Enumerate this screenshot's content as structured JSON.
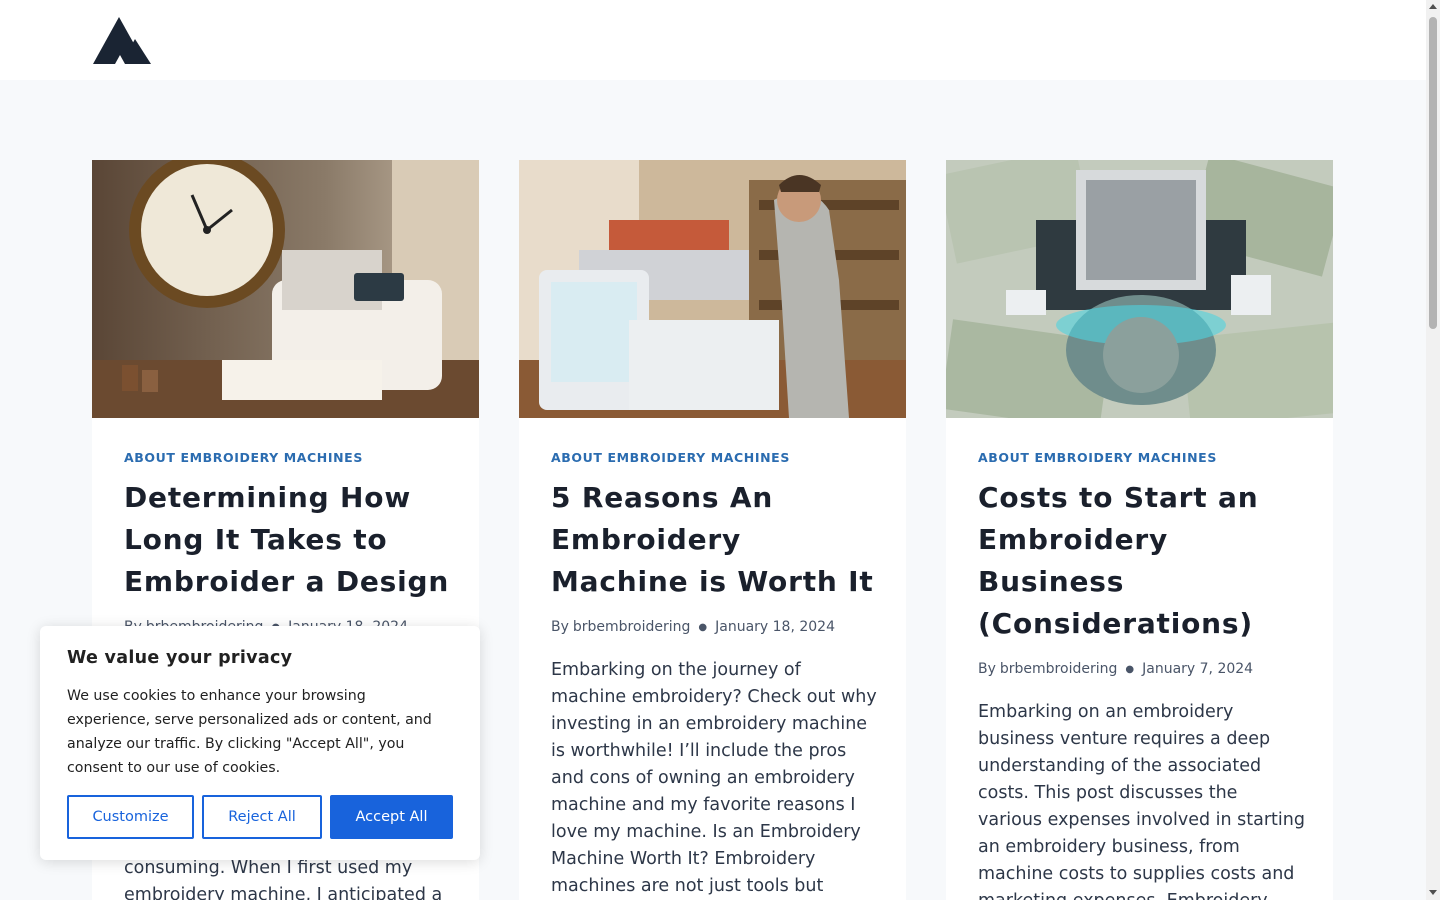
{
  "header": {
    "logo_icon": "triangle-mountain-logo"
  },
  "posts": [
    {
      "category": "ABOUT EMBROIDERY MACHINES",
      "title": "Determining How Long It Takes to Embroider a Design",
      "by": "By",
      "author": "brbembroidering",
      "date": "January 18, 2024",
      "excerpt": "consuming. When I first used my embroidery machine, I anticipated a",
      "image_alt": "sewing machine with wall clock"
    },
    {
      "category": "ABOUT EMBROIDERY MACHINES",
      "title": "5 Reasons An Embroidery Machine is Worth It",
      "by": "By",
      "author": "brbembroidering",
      "date": "January 18, 2024",
      "excerpt": "Embarking on the journey of machine embroidery? Check out why investing in an embroidery machine is worthwhile! I’ll include the pros and cons of owning an embroidery machine and my favorite reasons I love my machine. Is an Embroidery Machine Worth It? Embroidery machines are not just tools but",
      "image_alt": "man using embroidery machine"
    },
    {
      "category": "ABOUT EMBROIDERY MACHINES",
      "title": "Costs to Start an Embroidery Business (Considerations)",
      "by": "By",
      "author": "brbembroidering",
      "date": "January 7, 2024",
      "excerpt": "Embarking on an embroidery business venture requires a deep understanding of the associated costs. This post discusses the various expenses involved in starting an embroidery business, from machine costs to supplies costs and marketing expenses. Embroidery Business",
      "image_alt": "embroidery machine on dollar bills"
    }
  ],
  "cookie_banner": {
    "title": "We value your privacy",
    "text": "We use cookies to enhance your browsing experience, serve personalized ads or content, and analyze our traffic. By clicking \"Accept All\", you consent to our use of cookies.",
    "customize_label": "Customize",
    "reject_label": "Reject All",
    "accept_label": "Accept All"
  },
  "colors": {
    "accent": "#1863dc",
    "category": "#2b6cb0",
    "page_bg": "#f7f9fb"
  }
}
